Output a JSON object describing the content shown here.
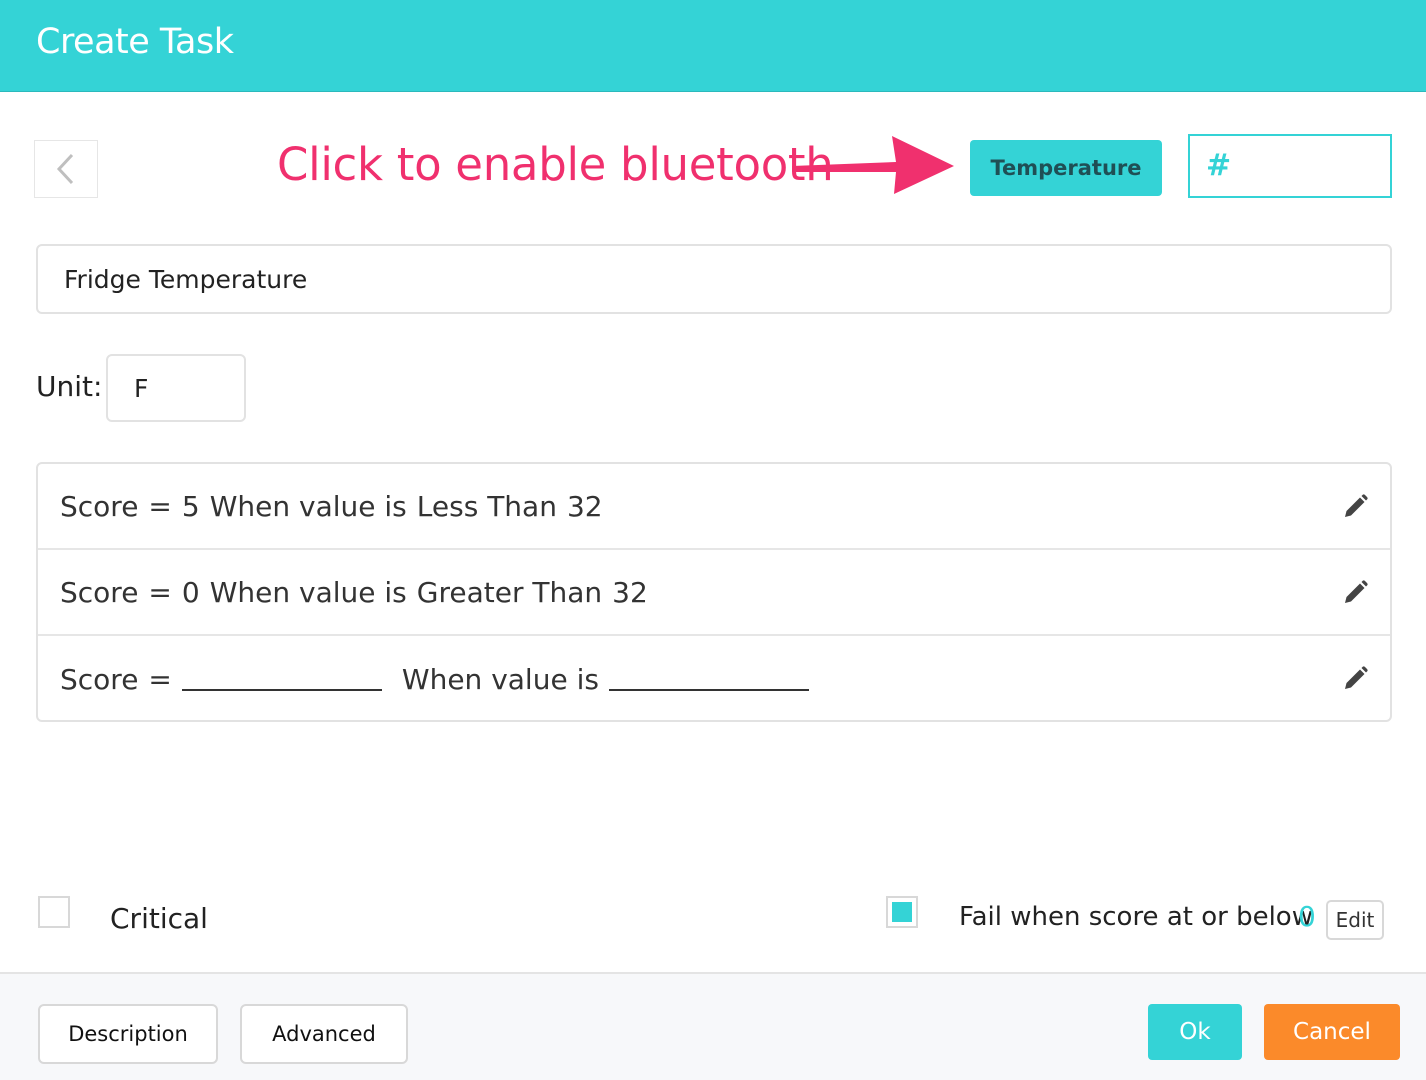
{
  "header": {
    "title": "Create Task"
  },
  "annotation": {
    "text": "Click to enable bluetooth",
    "color": "#f0306e"
  },
  "toolbar": {
    "back_icon": "chevron-left-icon",
    "type_button_label": "Temperature",
    "hash_symbol": "#"
  },
  "task": {
    "name_value": "Fridge Temperature",
    "unit_label": "Unit:",
    "unit_value": "F"
  },
  "rules": [
    {
      "score_label": "Score",
      "eq": "=",
      "score": "5",
      "when": "When value is",
      "condition": "Less Than",
      "threshold": "32"
    },
    {
      "score_label": "Score",
      "eq": "=",
      "score": "0",
      "when": "When value is",
      "condition": "Greater Than",
      "threshold": "32"
    },
    {
      "score_label": "Score",
      "eq": "=",
      "when": "When value is"
    }
  ],
  "options": {
    "critical_label": "Critical",
    "critical_checked": false,
    "fail_checked": true,
    "fail_label": "Fail when score at or below",
    "fail_value": "0",
    "edit_label": "Edit"
  },
  "footer": {
    "description_label": "Description",
    "advanced_label": "Advanced",
    "ok_label": "Ok",
    "cancel_label": "Cancel"
  },
  "colors": {
    "accent": "#34d3d6",
    "cancel": "#fb8a2a",
    "annotation": "#f0306e"
  }
}
